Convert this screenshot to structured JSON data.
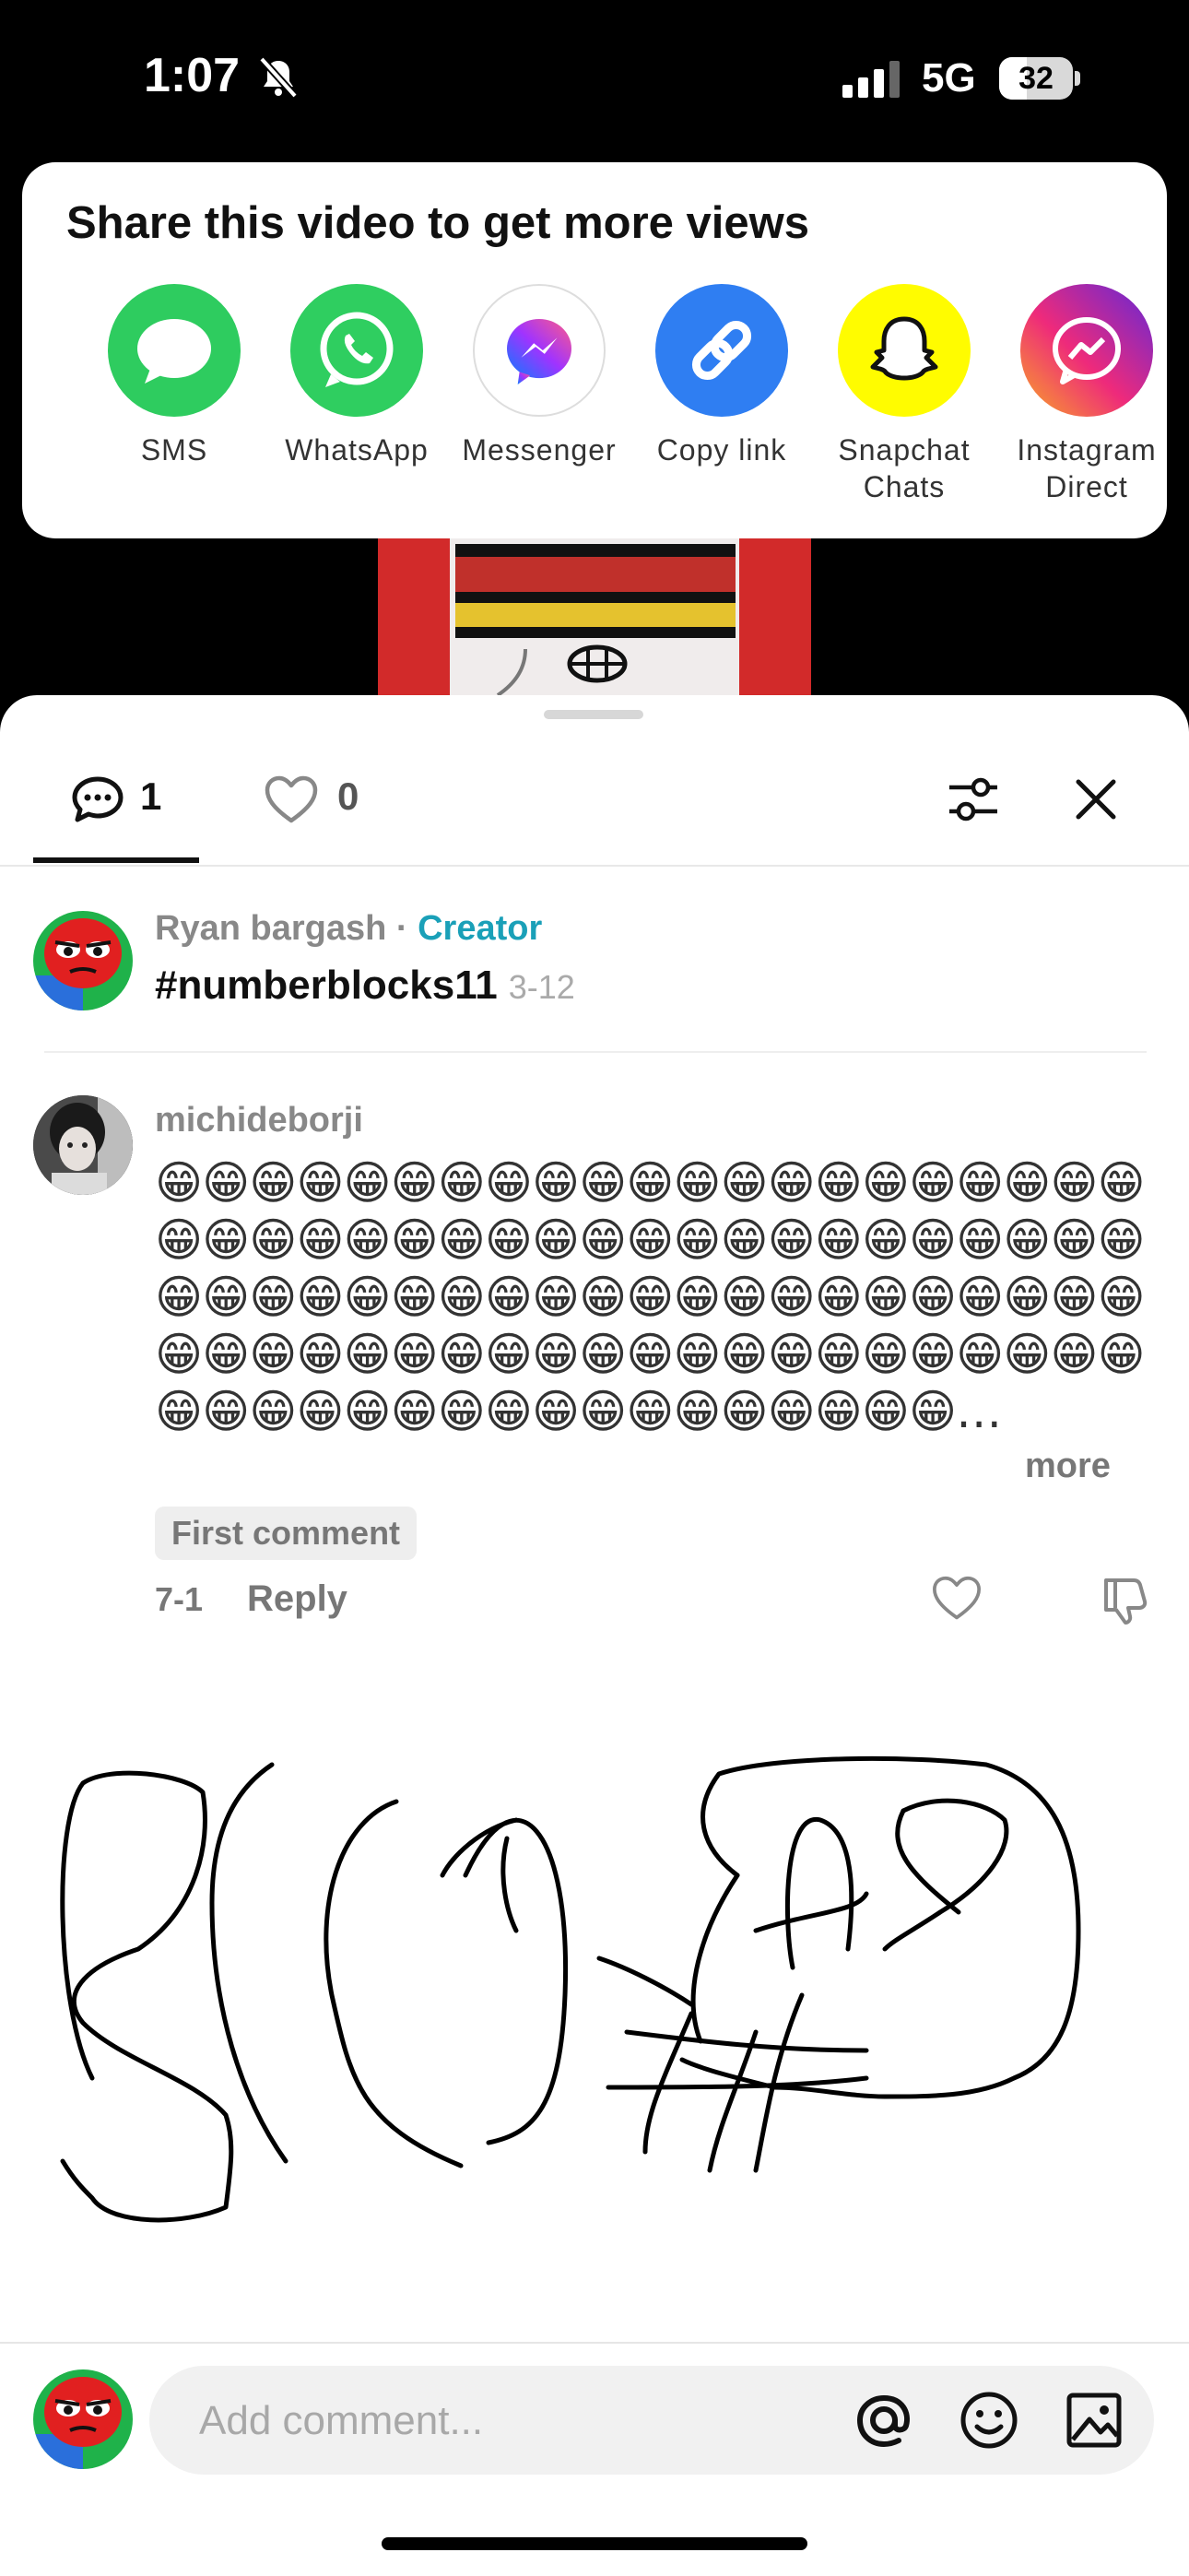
{
  "status_bar": {
    "time": "1:07",
    "network": "5G",
    "battery": "32"
  },
  "share": {
    "title": "Share this video to get more views",
    "items": [
      {
        "label": "SMS",
        "color": "#2ecc5f"
      },
      {
        "label": "WhatsApp",
        "color": "#2fce60"
      },
      {
        "label": "Messenger",
        "color": "#ffffff"
      },
      {
        "label": "Copy link",
        "color": "#2f7ef2"
      },
      {
        "label": "Snapchat\nChats",
        "color": "#fffc00"
      },
      {
        "label": "Instagram\nDirect",
        "color": "#e1306c"
      }
    ]
  },
  "tabs": {
    "comments_count": "1",
    "likes_count": "0"
  },
  "creator_post": {
    "author": "Ryan bargash",
    "separator": " · ",
    "role": "Creator",
    "caption": "#numberblocks11",
    "date": "3-12"
  },
  "comment": {
    "username": "michideborji",
    "text": "😁😁😁😁😁😁😁😁😁😁😁😁😁😁😁😁😁😁😁😁😁😁😁😁😁😁😁😁😁😁😁😁😁😁😁😁😁😁😁😁😁😁😁😁😁😁😁😁😁😁😁😁😁😁😁😁😁😁😁😁😁😁😁😁😁😁😁😁😁😁😁😁😁😁😁😁😁😁😁😁😁😁😁😁😁😁😁😁😁😁😁😁😁😁😁😁😁😁😁😁😁…",
    "more_label": "more",
    "badge": "First comment",
    "date": "7-1",
    "reply_label": "Reply"
  },
  "input": {
    "placeholder": "Add comment..."
  },
  "colors": {
    "accent": "#1aa0b8"
  }
}
